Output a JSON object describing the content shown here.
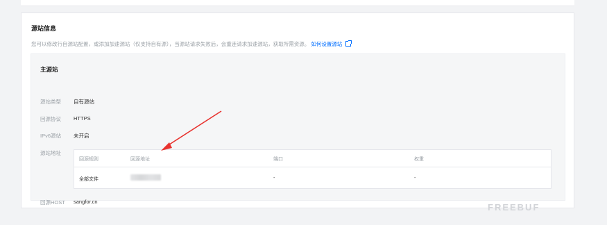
{
  "section": {
    "title": "源站信息",
    "description": "您可以修改行自源站配置，或添加加速源站（仅支持自有源），当源站请求失败后，会重连请求加速源站，获取所需资源。",
    "help_link": "如何设置源站"
  },
  "primary_origin": {
    "title": "主源站",
    "fields": [
      {
        "label": "源站类型",
        "value": "自有源站"
      },
      {
        "label": "回源协议",
        "value": "HTTPS"
      },
      {
        "label": "IPv6源站",
        "value": "未开启"
      },
      {
        "label": "源站地址",
        "value": ""
      },
      {
        "label": "回源HOST",
        "value": "sangfor.cn"
      }
    ],
    "table": {
      "headers": [
        "回源规则",
        "回源地址",
        "端口",
        "权重"
      ],
      "rows": [
        {
          "rule": "全部文件",
          "address": "",
          "port": "-",
          "weight": "-"
        }
      ]
    }
  },
  "annotation": {
    "color": "#e8322e"
  },
  "watermark": {
    "text": "FREEBUF"
  }
}
